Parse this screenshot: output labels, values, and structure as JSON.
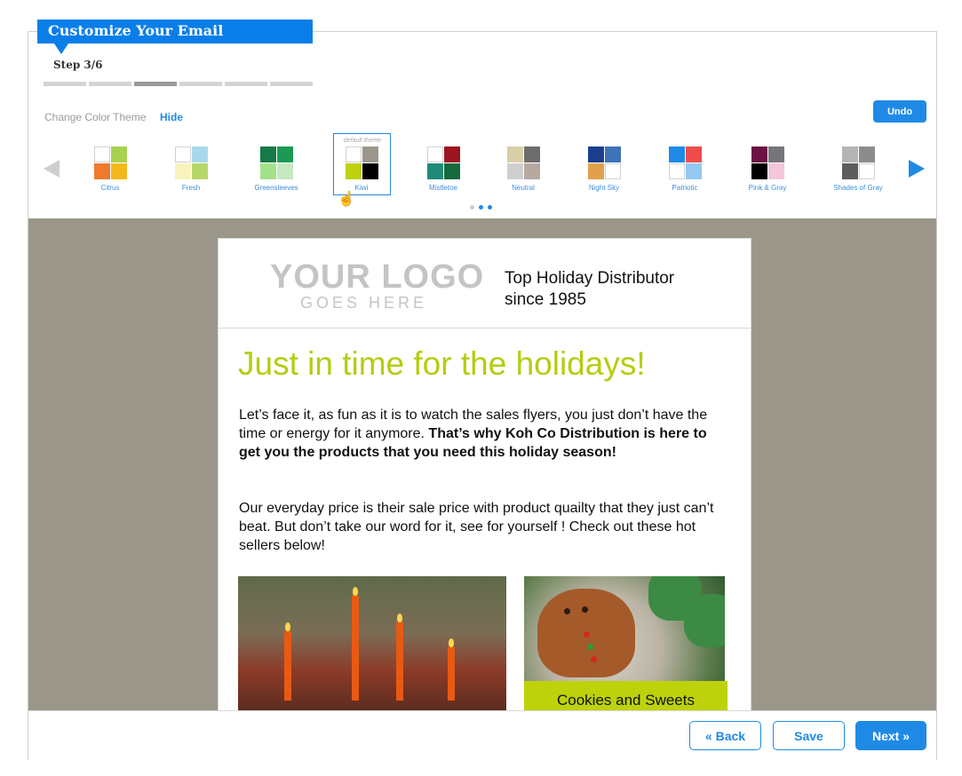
{
  "header": {
    "title": "Customize Your Email",
    "step": "Step 3/6",
    "progress": {
      "current": 3,
      "total": 6
    }
  },
  "theme_bar": {
    "label": "Change Color Theme",
    "hide_label": "Hide",
    "undo_label": "Undo",
    "default_tag": "default theme",
    "selected": "Kiwi",
    "page_dots": {
      "count": 3,
      "active": [
        2,
        3
      ]
    },
    "themes": [
      {
        "name": "Citrus",
        "colors": [
          "#ffffff",
          "#a8d14f",
          "#f07a2b",
          "#f2b81c"
        ]
      },
      {
        "name": "Fresh",
        "colors": [
          "#ffffff",
          "#a9d8ec",
          "#f8f3bd",
          "#b7d66a"
        ]
      },
      {
        "name": "Greensleeves",
        "colors": [
          "#157a45",
          "#1c9a55",
          "#a3e08a",
          "#c6e8c2"
        ]
      },
      {
        "name": "Kiwi",
        "colors": [
          "#ffffff",
          "#9a978a",
          "#bdd20a",
          "#000000"
        ]
      },
      {
        "name": "Mistletoe",
        "colors": [
          "#ffffff",
          "#9b1520",
          "#1f8a78",
          "#136b3c"
        ]
      },
      {
        "name": "Neutral",
        "colors": [
          "#d8cfa8",
          "#6f6c70",
          "#cfcfcf",
          "#b8a9a0"
        ]
      },
      {
        "name": "Night Sky",
        "colors": [
          "#1b3f8c",
          "#3d74b8",
          "#e3a04a",
          "#ffffff"
        ]
      },
      {
        "name": "Patriotic",
        "colors": [
          "#1f8ae6",
          "#f04c4c",
          "#ffffff",
          "#92c8f2"
        ]
      },
      {
        "name": "Pink & Gray",
        "colors": [
          "#6d1045",
          "#78757a",
          "#000000",
          "#f7c5da"
        ]
      },
      {
        "name": "Shades of Gray",
        "colors": [
          "#b4b4b4",
          "#8c8c8c",
          "#5d5d5d",
          "#ffffff"
        ]
      }
    ]
  },
  "email": {
    "logo_main": "YOUR LOGO",
    "logo_sub": "GOES HERE",
    "tagline": "Top Holiday Distributor since 1985",
    "headline": "Just in time for the holidays!",
    "para1_plain": "Let’s face it, as fun as it is to watch the sales flyers, you just don’t have the time or energy for it anymore. ",
    "para1_bold": "That’s why Koh Co Distribution is here to get you the products that you need this holiday season!",
    "para2": "Our everyday price is their sale price with product quailty that they just can’t beat. But don’t take our word for it, see for yourself ! Check out these hot sellers below!",
    "caption": "Cookies and Sweets"
  },
  "footer": {
    "back_label": "« Back",
    "save_label": "Save",
    "next_label": "Next »"
  },
  "colors": {
    "accent": "#1f8ae6",
    "headline": "#b5cc12",
    "canvas_bg": "#9a978a"
  }
}
